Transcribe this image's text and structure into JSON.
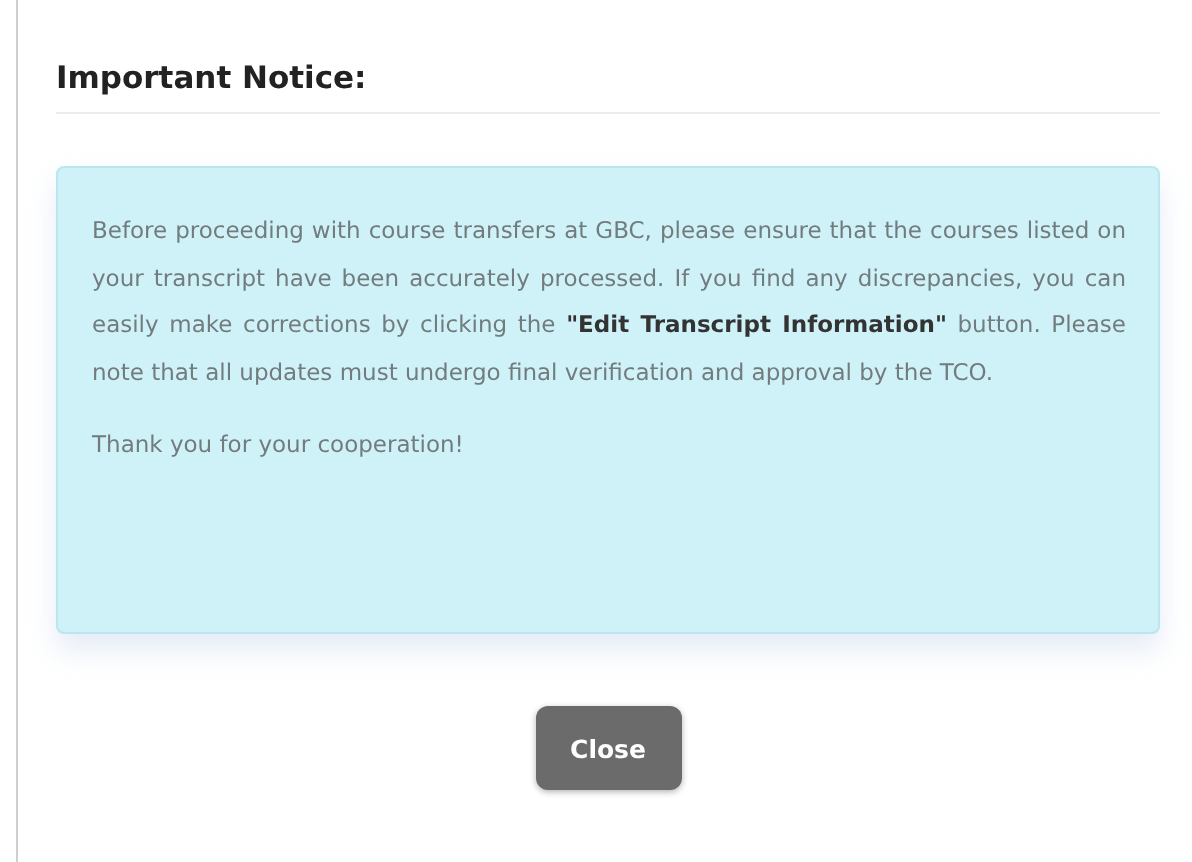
{
  "title": "Important Notice:",
  "notice": {
    "paragraphs": [
      "Before proceeding with course transfers at GBC, please ensure that the courses listed on your transcript have been accurately processed. If you find any discrepancies, you can easily make corrections by clicking the **\"Edit Transcript Information\"** button. Please note that all updates must undergo final verification and approval by the TCO.",
      "Thank you for your cooperation!"
    ]
  },
  "buttons": [
    {
      "label": "Close"
    }
  ]
}
